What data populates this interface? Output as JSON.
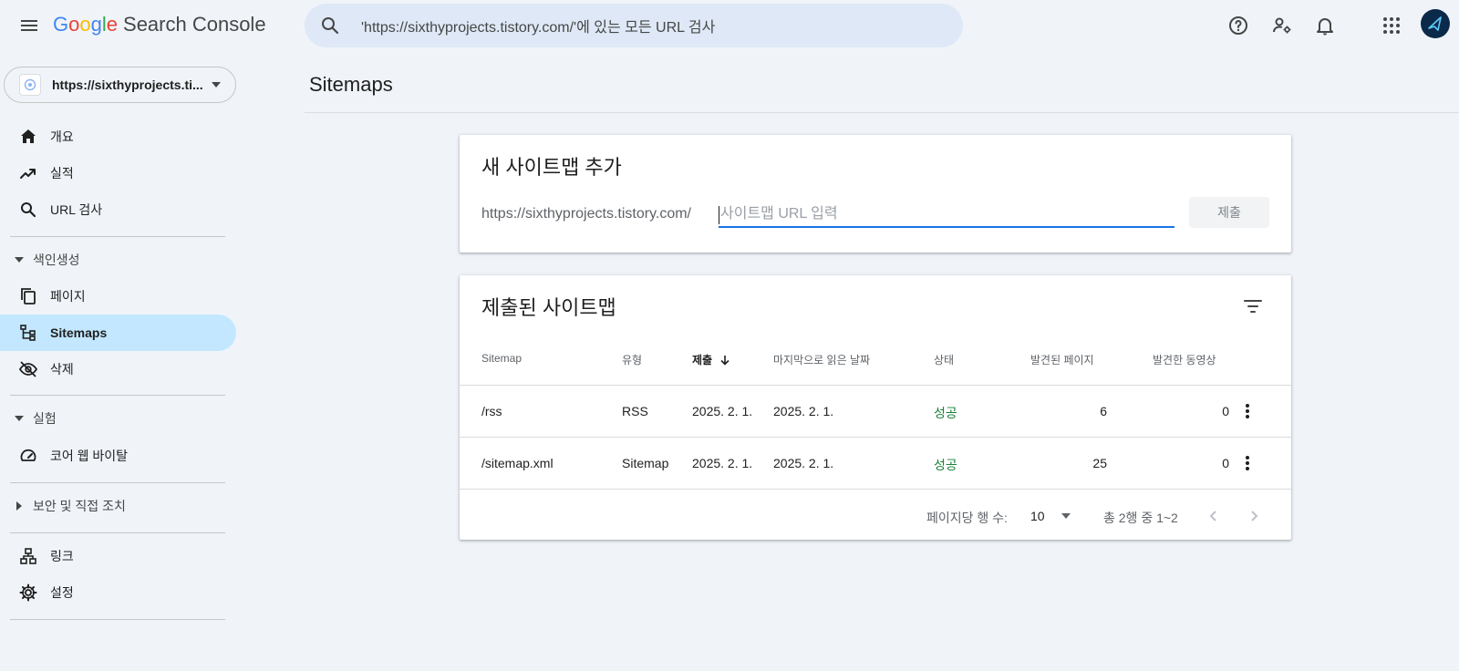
{
  "header": {
    "logo_letters": [
      "G",
      "o",
      "o",
      "g",
      "l",
      "e"
    ],
    "product": "Search Console",
    "search_placeholder": "'https://sixthyprojects.tistory.com/'에 있는 모든 URL 검사"
  },
  "property": {
    "label": "https://sixthyprojects.ti..."
  },
  "nav": {
    "overview": "개요",
    "performance": "실적",
    "url_inspection": "URL 검사",
    "indexing_section": "색인생성",
    "pages": "페이지",
    "sitemaps": "Sitemaps",
    "removals": "삭제",
    "experience_section": "실험",
    "core_web_vitals": "코어 웹 바이탈",
    "security_section": "보안 및 직접 조치",
    "links": "링크",
    "settings": "설정"
  },
  "page": {
    "title": "Sitemaps"
  },
  "add_sitemap": {
    "title": "새 사이트맵 추가",
    "prefix": "https://sixthyprojects.tistory.com/",
    "placeholder": "사이트맵 URL 입력",
    "submit_label": "제출"
  },
  "submitted": {
    "title": "제출된 사이트맵",
    "columns": {
      "sitemap": "Sitemap",
      "type": "유형",
      "submitted": "제출",
      "last_read": "마지막으로 읽은 날짜",
      "status": "상태",
      "discovered_pages": "발견된 페이지",
      "discovered_videos": "발견한 동영상"
    },
    "rows": [
      {
        "sitemap": "/rss",
        "type": "RSS",
        "submitted": "2025. 2. 1.",
        "last_read": "2025. 2. 1.",
        "status": "성공",
        "pages": "6",
        "videos": "0"
      },
      {
        "sitemap": "/sitemap.xml",
        "type": "Sitemap",
        "submitted": "2025. 2. 1.",
        "last_read": "2025. 2. 1.",
        "status": "성공",
        "pages": "25",
        "videos": "0"
      }
    ],
    "footer": {
      "rows_per_page_label": "페이지당 행 수:",
      "rows_per_page_value": "10",
      "range": "총 2행 중 1~2"
    }
  },
  "colors": {
    "accent": "#1a73e8",
    "active_nav": "#c2e7ff",
    "success": "#188038",
    "background": "#f0f4f9"
  },
  "icons": [
    "menu-icon",
    "search-icon",
    "help-icon",
    "manage-users-icon",
    "notifications-icon",
    "apps-icon",
    "home-icon",
    "trending-up-icon",
    "magnify-icon",
    "pages-icon",
    "sitemap-icon",
    "visibility-off-icon",
    "speed-icon",
    "links-icon",
    "settings-icon",
    "filter-icon",
    "more-vert-icon",
    "chevron-left-icon",
    "chevron-right-icon"
  ]
}
